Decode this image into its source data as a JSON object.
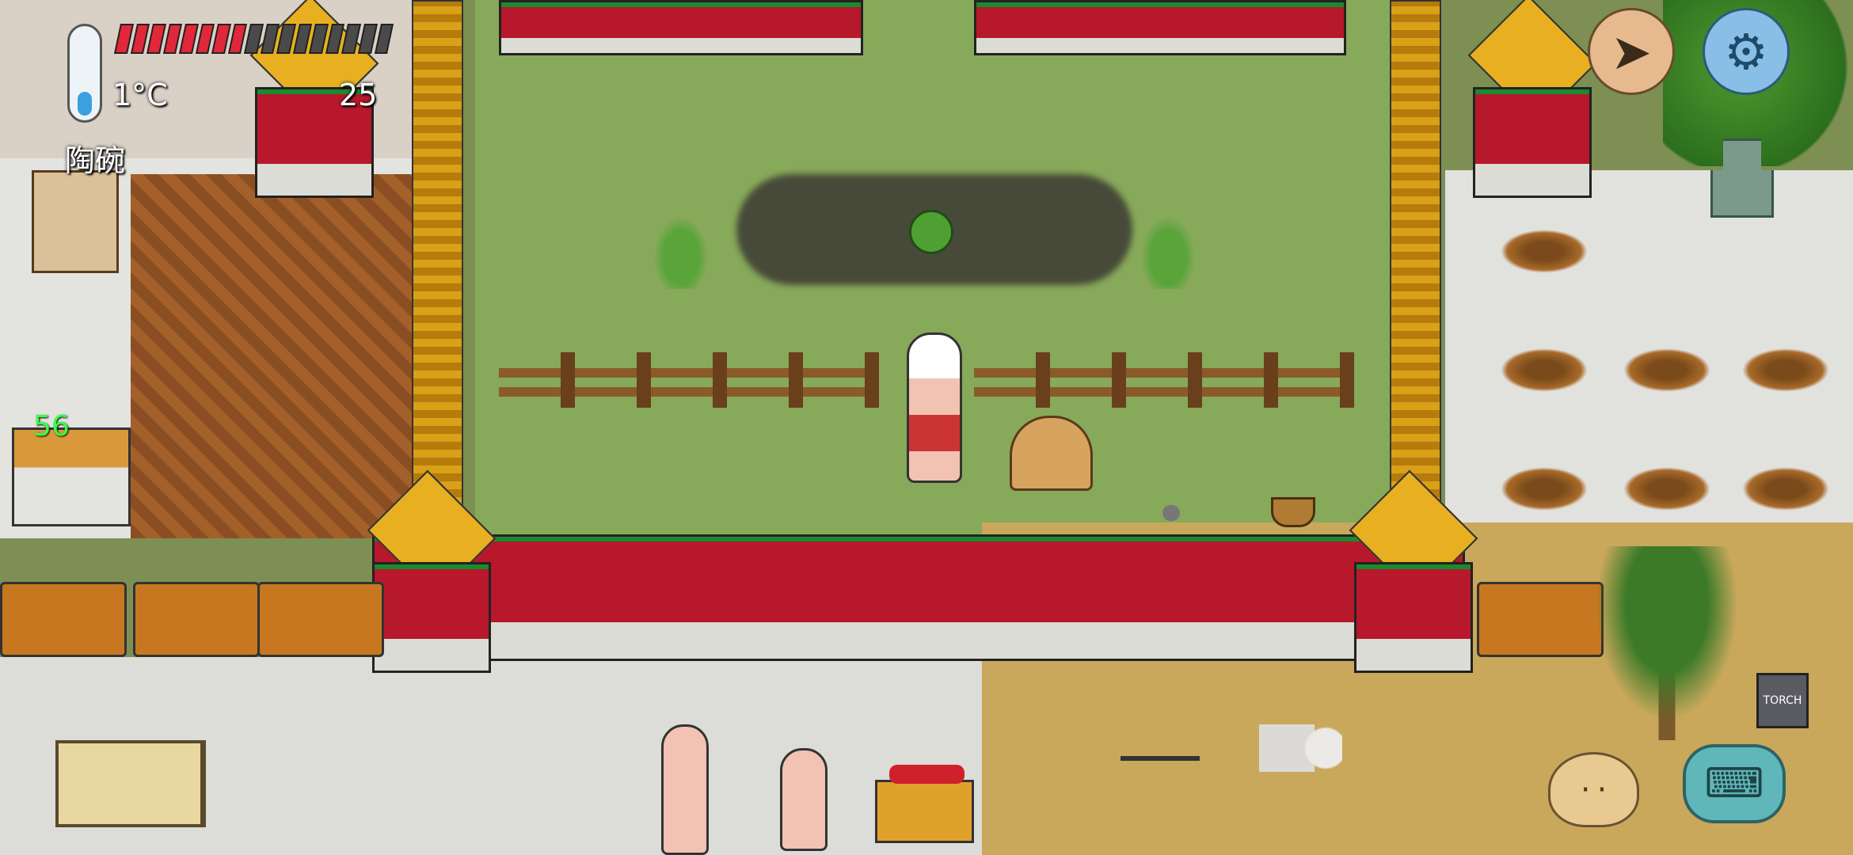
{
  "hud": {
    "temperature": "1°C",
    "age": "25",
    "held_item": "陶碗",
    "food_pips": {
      "full": 8,
      "total": 17
    },
    "marker_value": "56"
  },
  "world": {
    "torch_label": "TORCH"
  },
  "icons": {
    "thermometer": "thermometer-icon",
    "compass": "compass-icon",
    "settings": "gear-icon",
    "tech_tree": "recipe-book-icon",
    "emote": "emote-face-icon",
    "chat": "keyboard-chat-icon",
    "coin": "coin-icon"
  },
  "colors": {
    "food_full": "#e0283a",
    "food_empty": "#4a4a4a",
    "marker_green": "#3cff4a",
    "wall_red": "#b8182b",
    "wall_green": "#1a8a2f",
    "roof_gold": "#e8b021"
  }
}
